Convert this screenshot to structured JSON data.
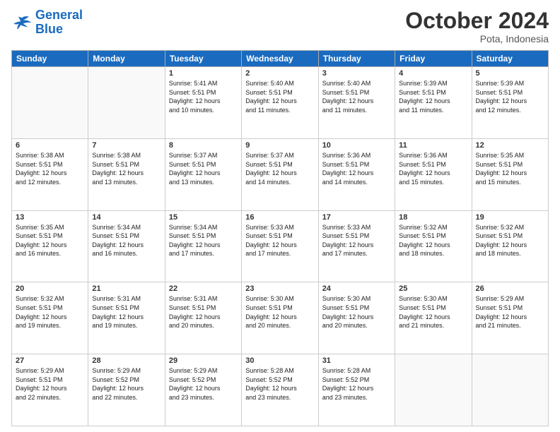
{
  "header": {
    "logo_line1": "General",
    "logo_line2": "Blue",
    "month": "October 2024",
    "location": "Pota, Indonesia"
  },
  "weekdays": [
    "Sunday",
    "Monday",
    "Tuesday",
    "Wednesday",
    "Thursday",
    "Friday",
    "Saturday"
  ],
  "weeks": [
    [
      {
        "day": "",
        "info": ""
      },
      {
        "day": "",
        "info": ""
      },
      {
        "day": "1",
        "info": "Sunrise: 5:41 AM\nSunset: 5:51 PM\nDaylight: 12 hours\nand 10 minutes."
      },
      {
        "day": "2",
        "info": "Sunrise: 5:40 AM\nSunset: 5:51 PM\nDaylight: 12 hours\nand 11 minutes."
      },
      {
        "day": "3",
        "info": "Sunrise: 5:40 AM\nSunset: 5:51 PM\nDaylight: 12 hours\nand 11 minutes."
      },
      {
        "day": "4",
        "info": "Sunrise: 5:39 AM\nSunset: 5:51 PM\nDaylight: 12 hours\nand 11 minutes."
      },
      {
        "day": "5",
        "info": "Sunrise: 5:39 AM\nSunset: 5:51 PM\nDaylight: 12 hours\nand 12 minutes."
      }
    ],
    [
      {
        "day": "6",
        "info": "Sunrise: 5:38 AM\nSunset: 5:51 PM\nDaylight: 12 hours\nand 12 minutes."
      },
      {
        "day": "7",
        "info": "Sunrise: 5:38 AM\nSunset: 5:51 PM\nDaylight: 12 hours\nand 13 minutes."
      },
      {
        "day": "8",
        "info": "Sunrise: 5:37 AM\nSunset: 5:51 PM\nDaylight: 12 hours\nand 13 minutes."
      },
      {
        "day": "9",
        "info": "Sunrise: 5:37 AM\nSunset: 5:51 PM\nDaylight: 12 hours\nand 14 minutes."
      },
      {
        "day": "10",
        "info": "Sunrise: 5:36 AM\nSunset: 5:51 PM\nDaylight: 12 hours\nand 14 minutes."
      },
      {
        "day": "11",
        "info": "Sunrise: 5:36 AM\nSunset: 5:51 PM\nDaylight: 12 hours\nand 15 minutes."
      },
      {
        "day": "12",
        "info": "Sunrise: 5:35 AM\nSunset: 5:51 PM\nDaylight: 12 hours\nand 15 minutes."
      }
    ],
    [
      {
        "day": "13",
        "info": "Sunrise: 5:35 AM\nSunset: 5:51 PM\nDaylight: 12 hours\nand 16 minutes."
      },
      {
        "day": "14",
        "info": "Sunrise: 5:34 AM\nSunset: 5:51 PM\nDaylight: 12 hours\nand 16 minutes."
      },
      {
        "day": "15",
        "info": "Sunrise: 5:34 AM\nSunset: 5:51 PM\nDaylight: 12 hours\nand 17 minutes."
      },
      {
        "day": "16",
        "info": "Sunrise: 5:33 AM\nSunset: 5:51 PM\nDaylight: 12 hours\nand 17 minutes."
      },
      {
        "day": "17",
        "info": "Sunrise: 5:33 AM\nSunset: 5:51 PM\nDaylight: 12 hours\nand 17 minutes."
      },
      {
        "day": "18",
        "info": "Sunrise: 5:32 AM\nSunset: 5:51 PM\nDaylight: 12 hours\nand 18 minutes."
      },
      {
        "day": "19",
        "info": "Sunrise: 5:32 AM\nSunset: 5:51 PM\nDaylight: 12 hours\nand 18 minutes."
      }
    ],
    [
      {
        "day": "20",
        "info": "Sunrise: 5:32 AM\nSunset: 5:51 PM\nDaylight: 12 hours\nand 19 minutes."
      },
      {
        "day": "21",
        "info": "Sunrise: 5:31 AM\nSunset: 5:51 PM\nDaylight: 12 hours\nand 19 minutes."
      },
      {
        "day": "22",
        "info": "Sunrise: 5:31 AM\nSunset: 5:51 PM\nDaylight: 12 hours\nand 20 minutes."
      },
      {
        "day": "23",
        "info": "Sunrise: 5:30 AM\nSunset: 5:51 PM\nDaylight: 12 hours\nand 20 minutes."
      },
      {
        "day": "24",
        "info": "Sunrise: 5:30 AM\nSunset: 5:51 PM\nDaylight: 12 hours\nand 20 minutes."
      },
      {
        "day": "25",
        "info": "Sunrise: 5:30 AM\nSunset: 5:51 PM\nDaylight: 12 hours\nand 21 minutes."
      },
      {
        "day": "26",
        "info": "Sunrise: 5:29 AM\nSunset: 5:51 PM\nDaylight: 12 hours\nand 21 minutes."
      }
    ],
    [
      {
        "day": "27",
        "info": "Sunrise: 5:29 AM\nSunset: 5:51 PM\nDaylight: 12 hours\nand 22 minutes."
      },
      {
        "day": "28",
        "info": "Sunrise: 5:29 AM\nSunset: 5:52 PM\nDaylight: 12 hours\nand 22 minutes."
      },
      {
        "day": "29",
        "info": "Sunrise: 5:29 AM\nSunset: 5:52 PM\nDaylight: 12 hours\nand 23 minutes."
      },
      {
        "day": "30",
        "info": "Sunrise: 5:28 AM\nSunset: 5:52 PM\nDaylight: 12 hours\nand 23 minutes."
      },
      {
        "day": "31",
        "info": "Sunrise: 5:28 AM\nSunset: 5:52 PM\nDaylight: 12 hours\nand 23 minutes."
      },
      {
        "day": "",
        "info": ""
      },
      {
        "day": "",
        "info": ""
      }
    ]
  ]
}
